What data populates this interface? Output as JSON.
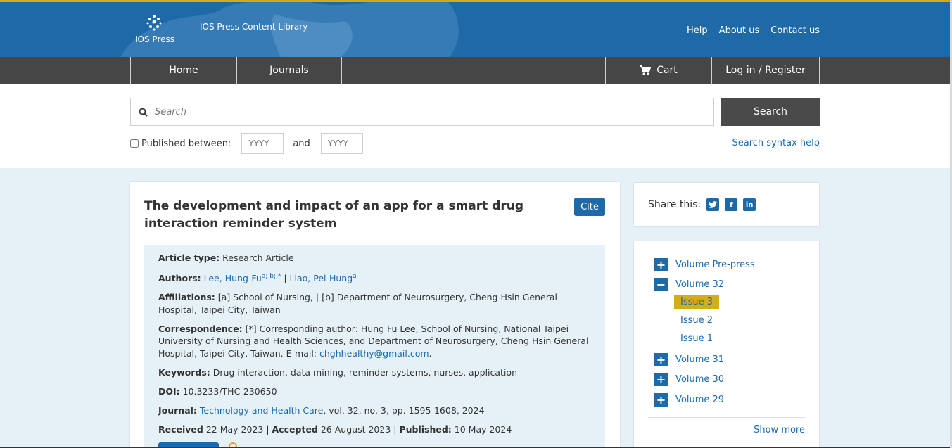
{
  "header": {
    "logo_text": "IOS Press",
    "site_title": "IOS Press Content Library",
    "links": [
      "Help",
      "About us",
      "Contact us"
    ]
  },
  "nav": {
    "home": "Home",
    "journals": "Journals",
    "cart": "Cart",
    "login": "Log in / Register"
  },
  "search": {
    "placeholder": "Search",
    "button": "Search",
    "published_between": "Published between:",
    "from_placeholder": "YYYY",
    "and": "and",
    "to_placeholder": "YYYY",
    "syntax_help": "Search syntax help"
  },
  "article": {
    "title": "The development and impact of an app for a smart drug interaction reminder system",
    "cite": "Cite",
    "article_type_label": "Article type:",
    "article_type": "Research Article",
    "authors_label": "Authors:",
    "author1": "Lee, Hung-Fu",
    "author1_sup": "a; b; *",
    "author_sep": "|",
    "author2": "Liao, Pei-Hung",
    "author2_sup": "a",
    "affiliations_label": "Affiliations:",
    "affiliations": "[a] School of Nursing, | [b] Department of Neurosurgery, Cheng Hsin General Hospital, Taipei City, Taiwan",
    "correspondence_label": "Correspondence:",
    "correspondence": "[*] Corresponding author: Hung Fu Lee, School of Nursing, National Taipei University of Nursing and Health Sciences, and Department of Neurosurgery, Cheng Hsin General Hospital, Taipei City, Taiwan. E-mail:",
    "email": "chghhealthy@gmail.com",
    "email_end": ".",
    "keywords_label": "Keywords:",
    "keywords": "Drug interaction, data mining, reminder systems, nurses, application",
    "doi_label": "DOI:",
    "doi": "10.3233/THC-230650",
    "journal_label": "Journal:",
    "journal_name": "Technology and Health Care",
    "journal_details": ", vol. 32, no. 3, pp. 1595-1608, 2024",
    "received_label": "Received",
    "received": "22 May 2023",
    "accepted_label": "Accepted",
    "accepted": "26 August 2023",
    "published_label": "Published:",
    "published": "10 May 2024",
    "sep": "|"
  },
  "share": {
    "label": "Share this:",
    "icons": [
      "twitter-icon",
      "facebook-icon",
      "linkedin-icon"
    ]
  },
  "volumes": {
    "items": [
      {
        "label": "Volume Pre-press",
        "sign": "+"
      },
      {
        "label": "Volume 32",
        "sign": "−"
      },
      {
        "label": "Volume 31",
        "sign": "+"
      },
      {
        "label": "Volume 30",
        "sign": "+"
      },
      {
        "label": "Volume 29",
        "sign": "+"
      }
    ],
    "issues": [
      "Issue 3",
      "Issue 2",
      "Issue 1"
    ],
    "show_more": "Show more"
  },
  "colors": {
    "brand_blue": "#1e69a7",
    "nav_dark": "#464646",
    "accent_gold": "#d4ad17",
    "content_bg": "#e6f1f7"
  }
}
